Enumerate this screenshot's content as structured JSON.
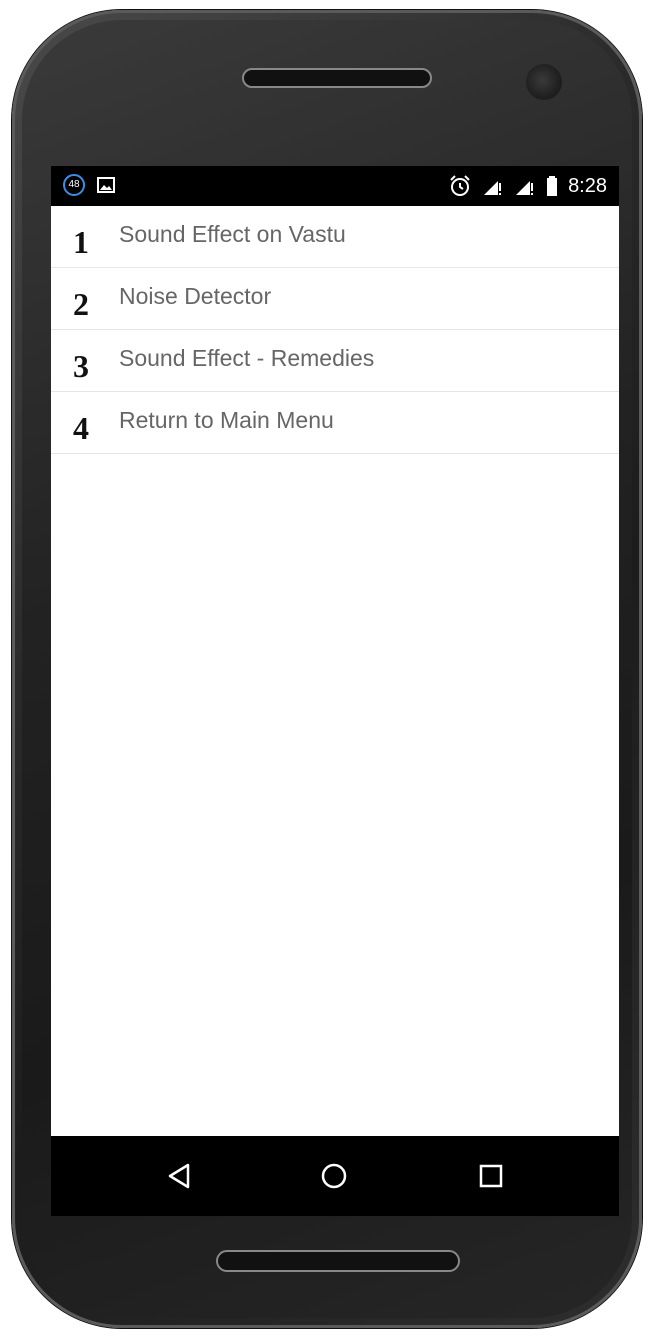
{
  "status_bar": {
    "notification_count": "48",
    "time": "8:28",
    "icons": [
      "notification-count-icon",
      "image-icon",
      "alarm-icon",
      "signal-icon",
      "signal-icon",
      "battery-icon"
    ]
  },
  "menu": {
    "items": [
      {
        "number": "1",
        "label": "Sound Effect on Vastu"
      },
      {
        "number": "2",
        "label": "Noise Detector"
      },
      {
        "number": "3",
        "label": "Sound Effect - Remedies"
      },
      {
        "number": "4",
        "label": "Return to Main Menu"
      }
    ]
  },
  "nav_bar": {
    "icons": [
      "back-icon",
      "home-icon",
      "recents-icon"
    ]
  },
  "colors": {
    "status_bar_bg": "#000000",
    "screen_bg": "#ffffff",
    "label_text": "#666666",
    "number_text": "#111111",
    "badge_ring": "#3b8ee8"
  }
}
